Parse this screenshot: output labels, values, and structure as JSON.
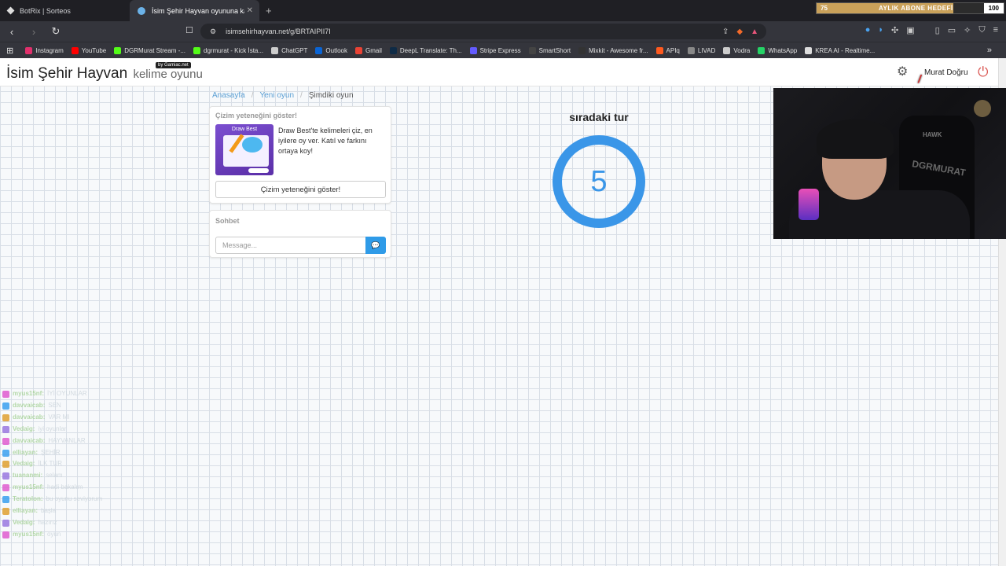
{
  "browser": {
    "tabs": [
      {
        "label": "BotRix | Sorteos",
        "active": false
      },
      {
        "label": "İsim Şehir Hayvan oyununa katıl",
        "active": true
      }
    ],
    "new_tab": "+",
    "close": "✕",
    "url": "isimsehirhayvan.net/g/BRTAIPII7I",
    "goal": {
      "current": "75",
      "label": "AYLIK ABONE HEDEFİ",
      "target": "100",
      "progress": 0.75
    },
    "bookmarks": [
      {
        "label": "Instagram",
        "color": "#e1306c"
      },
      {
        "label": "YouTube",
        "color": "#ff0000"
      },
      {
        "label": "DGRMurat Stream -...",
        "color": "#53fc18"
      },
      {
        "label": "dgrmurat - Kick İsta...",
        "color": "#53fc18"
      },
      {
        "label": "ChatGPT",
        "color": "#cccccc"
      },
      {
        "label": "Outlook",
        "color": "#0a64d4"
      },
      {
        "label": "Gmail",
        "color": "#ea4335"
      },
      {
        "label": "DeepL Translate: Th...",
        "color": "#0f2b46"
      },
      {
        "label": "Stripe Express",
        "color": "#635bff"
      },
      {
        "label": "SmartShort",
        "color": "#444444"
      },
      {
        "label": "Mixkit - Awesome fr...",
        "color": "#333333"
      },
      {
        "label": "APIq",
        "color": "#ff5a1f"
      },
      {
        "label": "LIVAD",
        "color": "#888888"
      },
      {
        "label": "Vodra",
        "color": "#cccccc"
      },
      {
        "label": "WhatsApp",
        "color": "#25d366"
      },
      {
        "label": "KREA AI - Realtime...",
        "color": "#dddddd"
      }
    ],
    "bookmarks_more": "»"
  },
  "site": {
    "brand": "İsim Şehir Hayvan",
    "brand_sub": "kelime oyunu",
    "badge": "by Gamiac.net",
    "user": "Murat Doğru",
    "breadcrumb": [
      "Anasayfa",
      "Yeni oyun",
      "Şimdiki oyun"
    ],
    "promo": {
      "title": "Çizim yeteneğini göster!",
      "image_title": "Draw Best",
      "text": "Draw Best'te kelimeleri çiz, en iyilere oy ver. Katıl ve farkını ortaya koy!",
      "button": "Çizim yeteneğini göster!"
    },
    "chat": {
      "title": "Sohbet",
      "placeholder": "Message..."
    },
    "next_round_label": "sıradaki tur",
    "countdown": "5"
  },
  "webcam": {
    "chair_brand": "HAWK",
    "chair_text": "DGRMURAT"
  },
  "stream_chat": [
    {
      "user": "myus15nf:",
      "msg": "İYİ OYUNLAR"
    },
    {
      "user": "davvaicab:",
      "msg": "SEN"
    },
    {
      "user": "davvaicab:",
      "msg": "VAR MI"
    },
    {
      "user": "Vedaig:",
      "msg": "iyi oyunlar"
    },
    {
      "user": "davvaicab:",
      "msg": "HAYVANLAR"
    },
    {
      "user": "elliayan:",
      "msg": "ŞEHİR"
    },
    {
      "user": "Vedaig:",
      "msg": "İLK TUR"
    },
    {
      "user": "tuananmi:",
      "msg": "selam"
    },
    {
      "user": "myus15nf:",
      "msg": "hadi bakalım"
    },
    {
      "user": "Teratolon:",
      "msg": "bu oyunu seviyorum"
    },
    {
      "user": "elliayan:",
      "msg": "başla"
    },
    {
      "user": "Vedaig:",
      "msg": "hazırız"
    },
    {
      "user": "myus15nf:",
      "msg": "oyun"
    }
  ]
}
